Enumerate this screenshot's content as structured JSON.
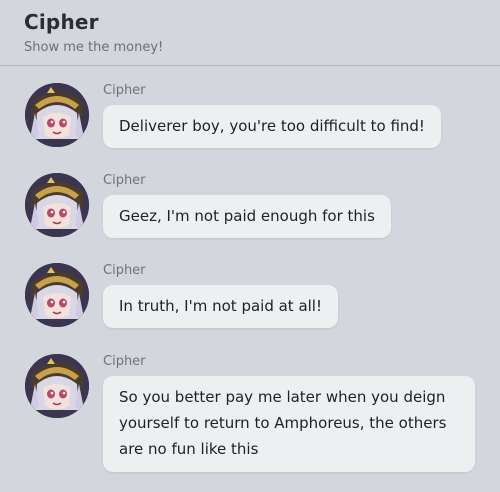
{
  "header": {
    "name": "Cipher",
    "status": "Show me the money!"
  },
  "messages": [
    {
      "sender": "Cipher",
      "text": "Deliverer boy, you're too difficult to find!",
      "avatar_icon": "cipher-avatar-icon"
    },
    {
      "sender": "Cipher",
      "text": "Geez, I'm not paid enough for this",
      "avatar_icon": "cipher-avatar-icon"
    },
    {
      "sender": "Cipher",
      "text": "In truth, I'm not paid at all!",
      "avatar_icon": "cipher-avatar-icon"
    },
    {
      "sender": "Cipher",
      "text": "So you better pay me later when you deign yourself to return to Amphoreus, the others are no fun like this",
      "avatar_icon": "cipher-avatar-icon"
    }
  ],
  "colors": {
    "background": "#d3d6dc",
    "bubble": "#eeeff1",
    "divider": "#b3b7bd"
  }
}
